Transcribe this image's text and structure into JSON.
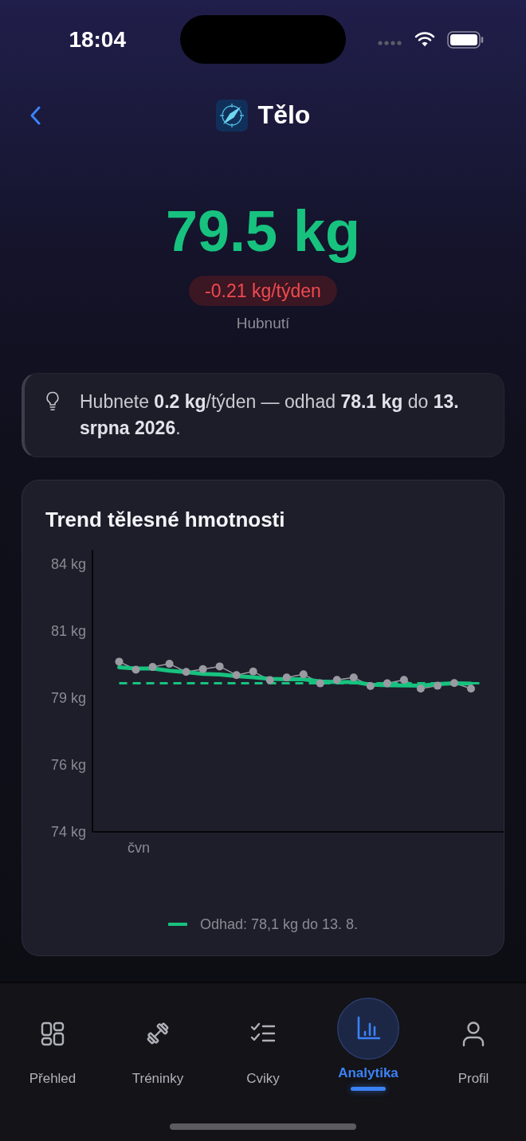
{
  "status_bar": {
    "time": "18:04"
  },
  "header": {
    "title": "Tělo"
  },
  "summary": {
    "weight": "79.5 kg",
    "rate": "-0.21 kg/týden",
    "trend_label": "Hubnutí"
  },
  "insight": {
    "text": "Hubnete **0.2 kg**/týden — odhad **78.1 kg** do **13. srpna 2026**."
  },
  "chart": {
    "chart_data": {
      "type": "line",
      "title": "Trend tělesné hmotnosti",
      "ylim": [
        74,
        84.54
      ],
      "yticks": [
        {
          "value": 84,
          "label": "84 kg"
        },
        {
          "value": 81.5,
          "label": "81 kg"
        },
        {
          "value": 79,
          "label": "79 kg"
        },
        {
          "value": 76.5,
          "label": "76 kg"
        },
        {
          "value": 74,
          "label": "74 kg"
        }
      ],
      "series": [
        {
          "color": "#9a9aa2",
          "marker": "circle",
          "values": [
            80.36,
            80.06,
            80.16,
            80.28,
            79.98,
            80.08,
            80.18,
            79.86,
            79.99,
            79.67,
            79.77,
            79.89,
            79.55,
            79.68,
            79.77,
            79.45,
            79.55,
            79.68,
            79.35,
            79.46,
            79.56,
            79.35
          ]
        },
        {
          "name": "Odhad: 78,1 kg do 13. 8.",
          "color": "#17c27f",
          "values": [
            80.15,
            80.1,
            80.1,
            80.02,
            79.97,
            79.9,
            79.88,
            79.82,
            79.78,
            79.72,
            79.7,
            79.7,
            79.62,
            79.6,
            79.6,
            79.5,
            79.48,
            79.47,
            79.46,
            79.52,
            79.55,
            79.54
          ]
        }
      ],
      "ref_lines": [
        {
          "axis": "y",
          "value": 79.55,
          "color": "#17c27f"
        }
      ],
      "annotations": [
        "čvn"
      ]
    }
  },
  "tab_bar": {
    "tabs": [
      {
        "label": "Přehled",
        "selected": false
      },
      {
        "label": "Tréninky",
        "selected": false
      },
      {
        "label": "Cviky",
        "selected": false
      },
      {
        "label": "Analytika",
        "selected": true
      },
      {
        "label": "Profil",
        "selected": false
      }
    ]
  }
}
